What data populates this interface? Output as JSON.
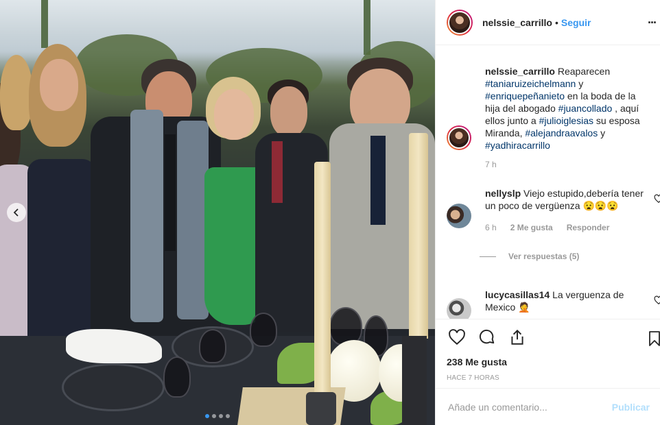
{
  "header": {
    "username": "nelssie_carrillo",
    "separator": "•",
    "follow_label": "Seguir",
    "more_label": "..."
  },
  "caption": {
    "username": "nelssie_carrillo",
    "text_1": "Reaparecen",
    "tag_1": "#taniaruizeichelmann",
    "text_2": "y",
    "tag_2": "#enriquepeñanieto",
    "text_3": "en la boda de la hija del abogado",
    "tag_3": "#juancollado",
    "text_4": ", aquí ellos junto a",
    "tag_4": "#julioiglesias",
    "text_5": "su esposa Miranda,",
    "tag_5": "#alejandraavalos",
    "text_6": "y",
    "tag_6": "#yadhiracarrillo",
    "time": "7 h"
  },
  "comments": [
    {
      "username": "nellyslp",
      "text": "Viejo estupido,debería tener un poco de vergüenza 😧😧😧",
      "time": "6 h",
      "likes": "2 Me gusta",
      "reply_label": "Responder",
      "view_replies": "Ver respuestas (5)"
    },
    {
      "username": "lucycasillas14",
      "text": "La verguenza de Mexico 🤦"
    }
  ],
  "actions": {
    "like_icon": "heart-icon",
    "comment_icon": "comment-icon",
    "share_icon": "share-icon",
    "save_icon": "bookmark-icon",
    "likes_count": "238 Me gusta",
    "posted_time": "HACE 7 HORAS"
  },
  "add_comment": {
    "placeholder": "Añade un comentario...",
    "publish_label": "Publicar"
  },
  "carousel": {
    "total_slides": 4,
    "active_slide": 1
  },
  "colors": {
    "link_blue": "#3897f0",
    "hashtag_blue": "#003569",
    "muted_gray": "#999999",
    "publish_disabled": "#b2dffc"
  }
}
